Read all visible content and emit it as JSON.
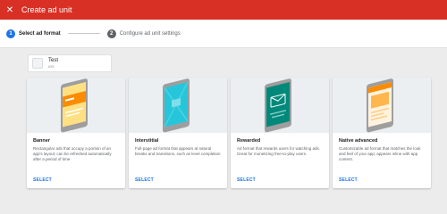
{
  "appbar": {
    "title": "Create ad unit",
    "close_icon": "close-icon",
    "background": "#d93025"
  },
  "stepper": {
    "steps": [
      {
        "number": "1",
        "label": "Select ad format",
        "state": "active"
      },
      {
        "number": "2",
        "label": "Configure ad unit settings",
        "state": "inactive"
      }
    ]
  },
  "app": {
    "name": "Test",
    "platform": "iOS",
    "icon": "apple-icon"
  },
  "cards": [
    {
      "title": "Banner",
      "description": "Rectangular ads that occupy a portion of an app's layout; can be refreshed automatically after a period of time",
      "action": "SELECT",
      "illustration": "banner-illustration",
      "accent": "#f9a825"
    },
    {
      "title": "Interstitial",
      "description": "Full-page ad format that appears at natural breaks and transitions, such as level completion",
      "action": "SELECT",
      "illustration": "interstitial-illustration",
      "accent": "#26c6da"
    },
    {
      "title": "Rewarded",
      "description": "Ad format that rewards users for watching ads. Great for monetizing free-to-play users.",
      "action": "SELECT",
      "illustration": "rewarded-illustration",
      "accent": "#00897b"
    },
    {
      "title": "Native advanced",
      "description": "Customizable ad format that matches the look and feel of your app; appears inline with app content.",
      "action": "SELECT",
      "illustration": "native-illustration",
      "accent": "#fb8c00"
    }
  ],
  "colors": {
    "primary": "#1a73e8",
    "brand_red": "#d93025"
  }
}
